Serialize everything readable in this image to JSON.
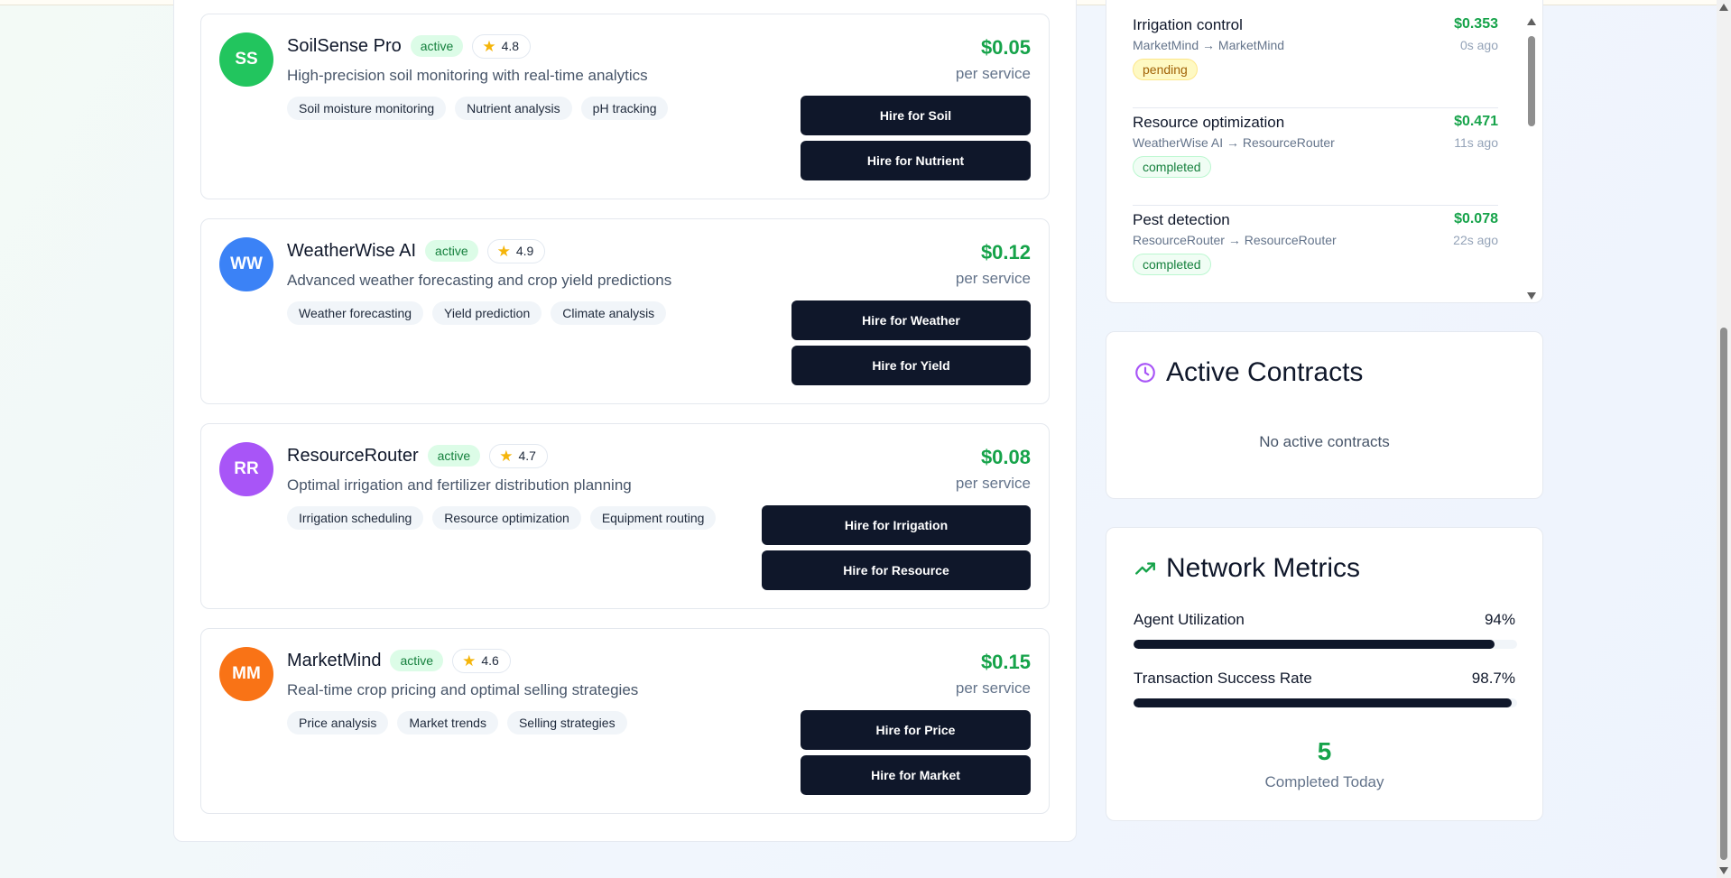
{
  "agents": [
    {
      "initials": "SS",
      "color": "#22c55e",
      "name": "SoilSense Pro",
      "status": "active",
      "rating": "4.8",
      "description": "High-precision soil monitoring with real-time analytics",
      "tags": [
        "Soil moisture monitoring",
        "Nutrient analysis",
        "pH tracking"
      ],
      "price": "$0.05",
      "price_unit": "per service",
      "buttons": [
        "Hire for Soil",
        "Hire for Nutrient"
      ]
    },
    {
      "initials": "WW",
      "color": "#3b82f6",
      "name": "WeatherWise AI",
      "status": "active",
      "rating": "4.9",
      "description": "Advanced weather forecasting and crop yield predictions",
      "tags": [
        "Weather forecasting",
        "Yield prediction",
        "Climate analysis"
      ],
      "price": "$0.12",
      "price_unit": "per service",
      "buttons": [
        "Hire for Weather",
        "Hire for Yield"
      ]
    },
    {
      "initials": "RR",
      "color": "#a855f7",
      "name": "ResourceRouter",
      "status": "active",
      "rating": "4.7",
      "description": "Optimal irrigation and fertilizer distribution planning",
      "tags": [
        "Irrigation scheduling",
        "Resource optimization",
        "Equipment routing"
      ],
      "price": "$0.08",
      "price_unit": "per service",
      "buttons": [
        "Hire for Irrigation",
        "Hire for Resource"
      ]
    },
    {
      "initials": "MM",
      "color": "#f97316",
      "name": "MarketMind",
      "status": "active",
      "rating": "4.6",
      "description": "Real-time crop pricing and optimal selling strategies",
      "tags": [
        "Price analysis",
        "Market trends",
        "Selling strategies"
      ],
      "price": "$0.15",
      "price_unit": "per service",
      "buttons": [
        "Hire for Price",
        "Hire for Market"
      ]
    }
  ],
  "transactions": [
    {
      "title": "Irrigation control",
      "amount": "$0.353",
      "route": "MarketMind → MarketMind",
      "time": "0s ago",
      "status": "pending"
    },
    {
      "title": "Resource optimization",
      "amount": "$0.471",
      "route": "WeatherWise AI → ResourceRouter",
      "time": "11s ago",
      "status": "completed"
    },
    {
      "title": "Pest detection",
      "amount": "$0.078",
      "route": "ResourceRouter → ResourceRouter",
      "time": "22s ago",
      "status": "completed"
    }
  ],
  "contracts": {
    "title": "Active Contracts",
    "empty_message": "No active contracts",
    "icon": "clock-icon",
    "icon_color": "#a855f7"
  },
  "metrics": {
    "title": "Network Metrics",
    "icon": "trending-up-icon",
    "icon_color": "#16a34a",
    "items": [
      {
        "label": "Agent Utilization",
        "value": "94%",
        "fraction": 0.94
      },
      {
        "label": "Transaction Success Rate",
        "value": "98.7%",
        "fraction": 0.987
      }
    ],
    "completed_count": "5",
    "completed_label": "Completed Today"
  }
}
